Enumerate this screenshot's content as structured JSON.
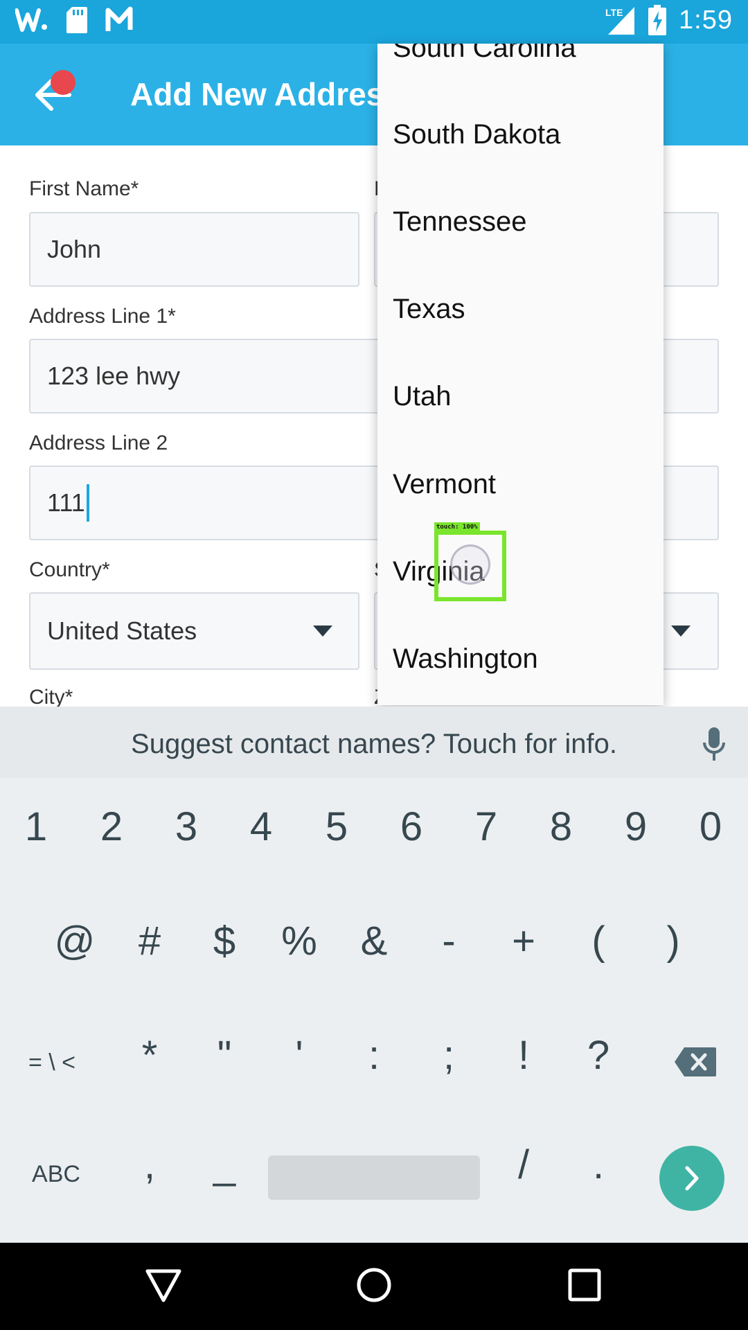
{
  "status_bar": {
    "time": "1:59",
    "network": "LTE",
    "icons": [
      "w-app-icon",
      "sd-card-icon",
      "n-app-icon",
      "signal-icon",
      "battery-charging-icon"
    ]
  },
  "app_bar": {
    "title": "Add New Address",
    "back_icon": "arrow-left-icon"
  },
  "form": {
    "first_name": {
      "label": "First Name*",
      "value": "John"
    },
    "last_name": {
      "label": "L"
    },
    "address1": {
      "label": "Address Line 1*",
      "value": "123 lee hwy"
    },
    "address2": {
      "label": "Address Line 2",
      "value": "111"
    },
    "country": {
      "label": "Country*",
      "value": "United States"
    },
    "state": {
      "label": "S"
    },
    "city": {
      "label": "City*"
    },
    "zip": {
      "label": "Z"
    }
  },
  "dropdown": {
    "items": [
      "South Carolina",
      "South Dakota",
      "Tennessee",
      "Texas",
      "Utah",
      "Vermont",
      "Virginia",
      "Washington"
    ]
  },
  "touch": {
    "label": "touch: 100%"
  },
  "keyboard": {
    "suggestion": "Suggest contact names? Touch for info.",
    "row1": [
      "1",
      "2",
      "3",
      "4",
      "5",
      "6",
      "7",
      "8",
      "9",
      "0"
    ],
    "row2": [
      "@",
      "#",
      "$",
      "%",
      "&",
      "-",
      "+",
      "(",
      ")"
    ],
    "row3": [
      "= \\ <",
      "*",
      "\"",
      "'",
      ":",
      ";",
      "!",
      "?"
    ],
    "row4": [
      "ABC",
      ",",
      "_",
      "/",
      "."
    ]
  }
}
